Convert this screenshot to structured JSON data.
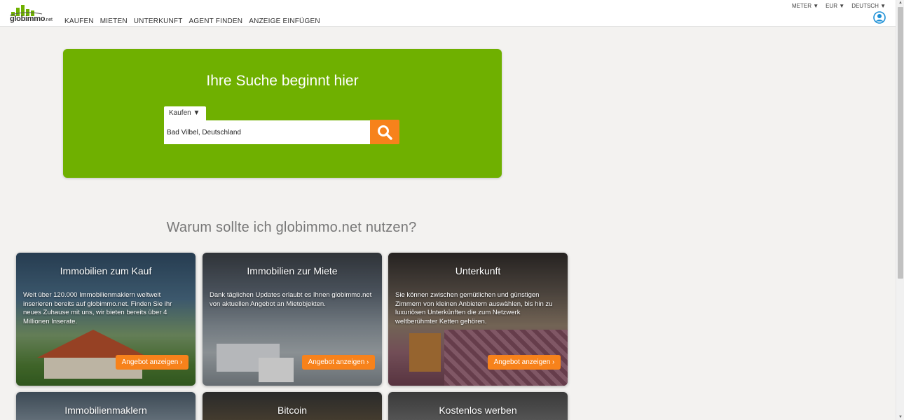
{
  "header": {
    "logo_text": "globimmo",
    "logo_suffix": ".net",
    "nav": [
      "KAUFEN",
      "MIETEN",
      "UNTERKUNFT",
      "AGENT FINDEN",
      "ANZEIGE EINFÜGEN"
    ],
    "units_label": "METER ▼",
    "currency_label": "EUR ▼",
    "language_label": "DEUTSCH ▼"
  },
  "hero": {
    "title": "Ihre Suche beginnt hier",
    "mode_label": "Kaufen ▼",
    "search_value": "Bad Vilbel, Deutschland"
  },
  "section": {
    "title": "Warum sollte ich globimmo.net nutzen?"
  },
  "cards": [
    {
      "title": "Immobilien zum Kauf",
      "text": "Weit über 120.000 Immobilienmaklern weltweit inserieren bereits auf globimmo.net. Finden Sie ihr neues Zuhause mit uns, wir bieten bereits über 4 Millionen Inserate.",
      "button": "Angebot anzeigen ›"
    },
    {
      "title": "Immobilien zur Miete",
      "text": "Dank täglichen Updates erlaubt es Ihnen globimmo.net von aktuellen Angebot an Mietobjekten.",
      "button": "Angebot anzeigen ›"
    },
    {
      "title": "Unterkunft",
      "text": "Sie können zwischen gemütlichen und günstigen Zimmern von kleinen Anbietern auswählen, bis hin zu luxuriösen Unterkünften die zum Netzwerk weltberühmter Ketten gehören.",
      "button": "Angebot anzeigen ›"
    },
    {
      "title": "Immobilienmaklern"
    },
    {
      "title": "Bitcoin"
    },
    {
      "title": "Kostenlos werben"
    }
  ],
  "colors": {
    "accent_green": "#6fb000",
    "accent_orange": "#f7821b",
    "user_icon": "#1a8fd6"
  }
}
